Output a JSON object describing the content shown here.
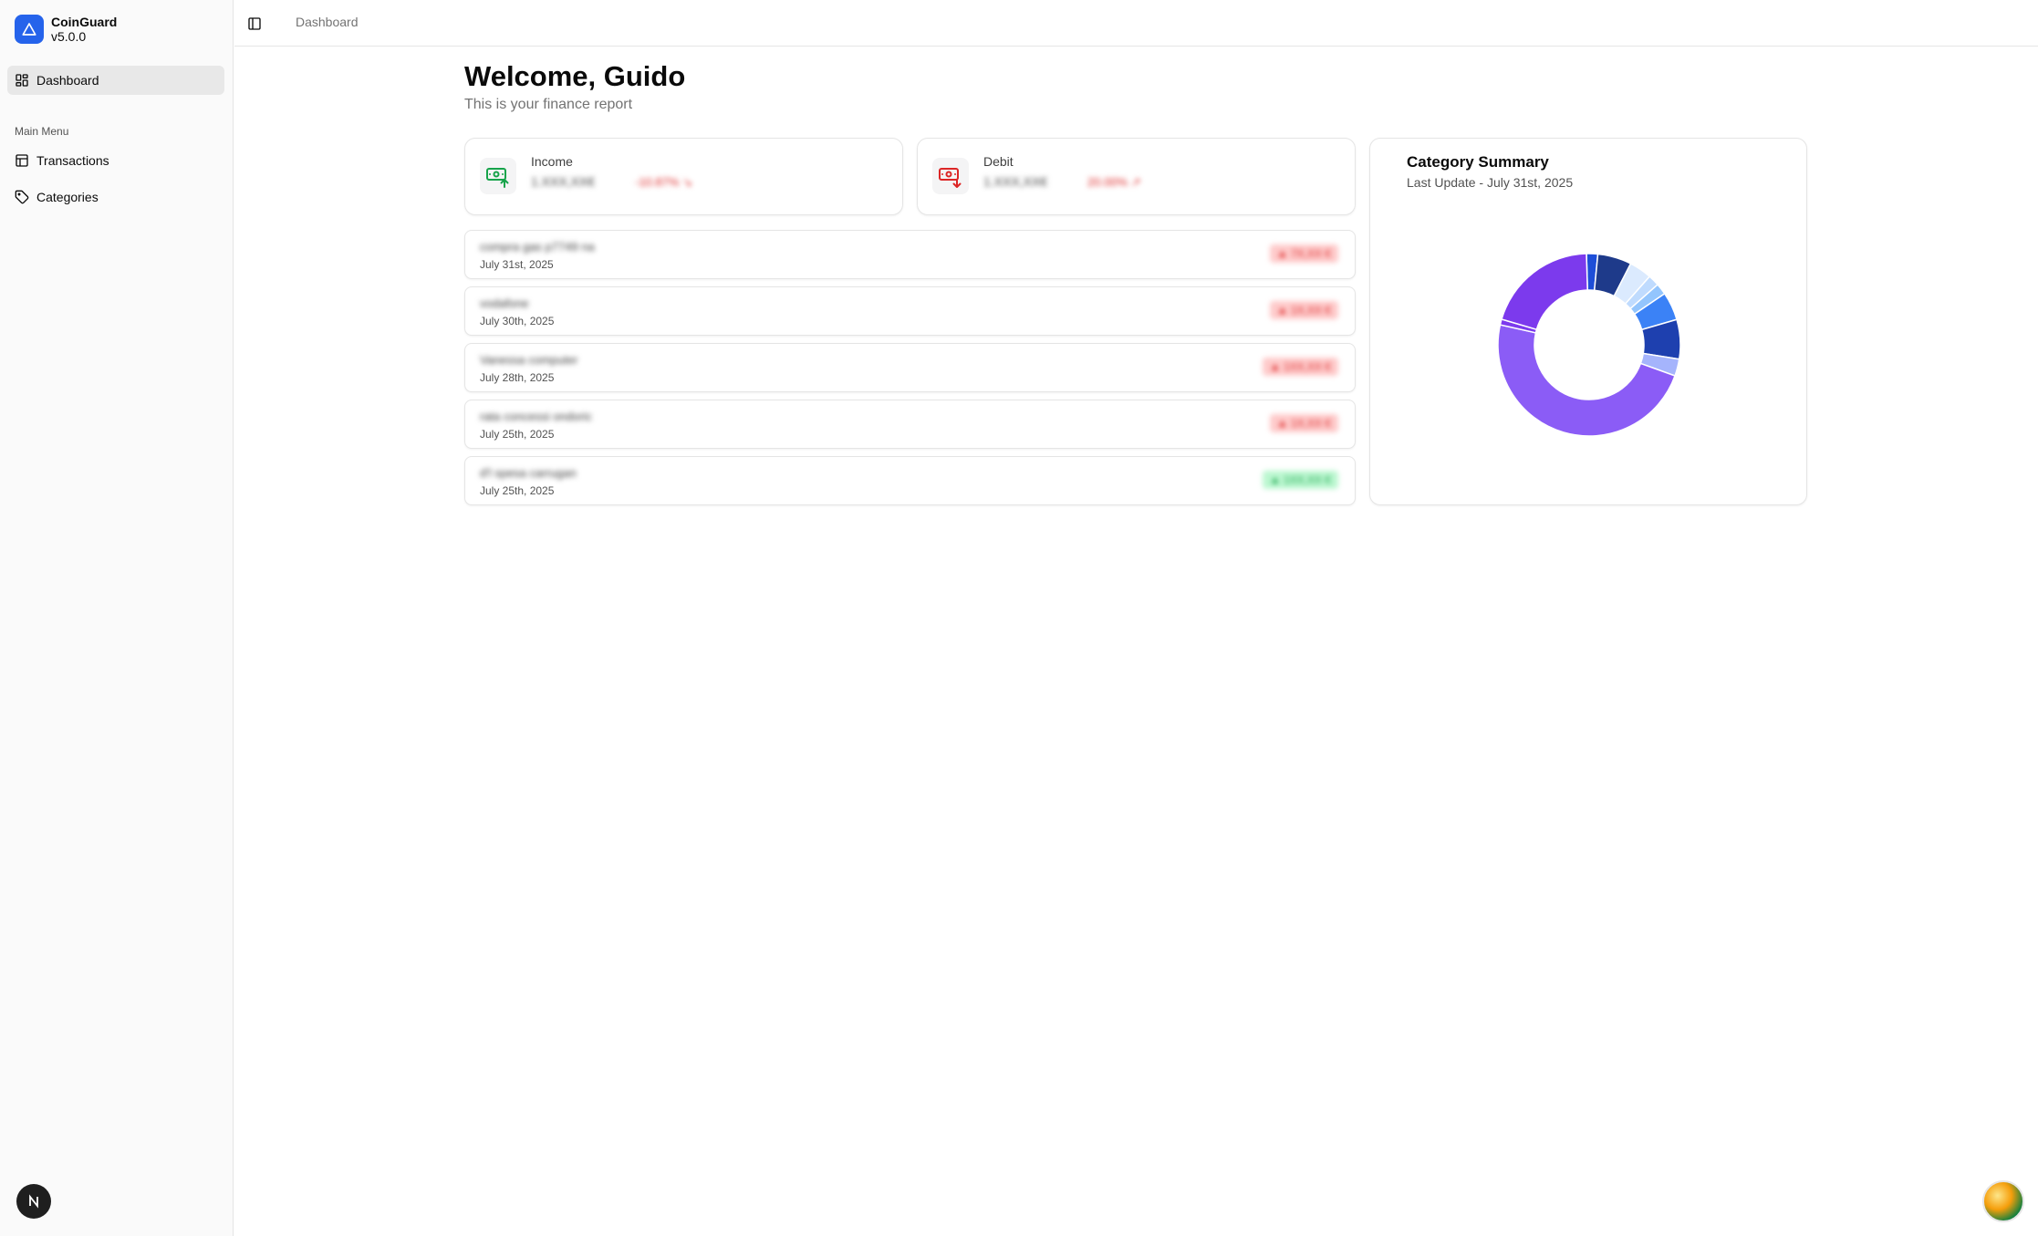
{
  "app": {
    "name": "CoinGuard",
    "version": "v5.0.0"
  },
  "sidebar": {
    "items": [
      {
        "label": "Dashboard",
        "icon": "dashboard-icon",
        "active": true
      },
      {
        "label": "Transactions",
        "icon": "table-icon"
      },
      {
        "label": "Categories",
        "icon": "tag-icon"
      }
    ],
    "section_label": "Main Menu",
    "dev_badge": "N"
  },
  "topbar": {
    "breadcrumb": "Dashboard"
  },
  "main": {
    "welcome": "Welcome, Guido",
    "subtitle": "This is your finance report"
  },
  "stats": {
    "income": {
      "label": "Income",
      "amount": "1.XXX,XX€",
      "change": "-10.87% ↘"
    },
    "debit": {
      "label": "Debit",
      "amount": "1.XXX,XX€",
      "change": "20.00% ↗"
    }
  },
  "transactions": [
    {
      "description": "compra gas p7749 na",
      "date": "July 31st, 2025",
      "amount": "▲ 7X,XX €",
      "type": "negative"
    },
    {
      "description": "vodafone",
      "date": "July 30th, 2025",
      "amount": "▲ 1X,XX €",
      "type": "negative"
    },
    {
      "description": "Vanessa computer",
      "date": "July 28th, 2025",
      "amount": "▲ 1XX,XX €",
      "type": "negative"
    },
    {
      "description": "rata concessi ondoric",
      "date": "July 25th, 2025",
      "amount": "▲ 1X,XX €",
      "type": "negative"
    },
    {
      "description": "d'l spesa carrugan",
      "date": "July 25th, 2025",
      "amount": "▲ 1XX,XX €",
      "type": "positive"
    }
  ],
  "category_summary": {
    "title": "Category Summary",
    "subtitle": "Last Update - July 31st, 2025"
  },
  "chart_data": {
    "type": "pie",
    "donut": true,
    "legend": "none",
    "slices": [
      {
        "value": 2,
        "color": "#1d4ed8"
      },
      {
        "value": 6,
        "color": "#1e3a8a"
      },
      {
        "value": 4,
        "color": "#dbeafe"
      },
      {
        "value": 2,
        "color": "#bfdbfe"
      },
      {
        "value": 2,
        "color": "#93c5fd"
      },
      {
        "value": 5,
        "color": "#3b82f6"
      },
      {
        "value": 7,
        "color": "#1e40af"
      },
      {
        "value": 3,
        "color": "#a5b4fc"
      },
      {
        "value": 48,
        "color": "#8b5cf6"
      },
      {
        "value": 1,
        "color": "#7c3aed"
      },
      {
        "value": 20,
        "color": "#7c3aed"
      }
    ]
  },
  "colors": {
    "brand": "#2563eb",
    "income_icon": "#16a34a",
    "debit_icon": "#dc2626",
    "negative": "#dc2626",
    "positive": "#16a34a"
  }
}
